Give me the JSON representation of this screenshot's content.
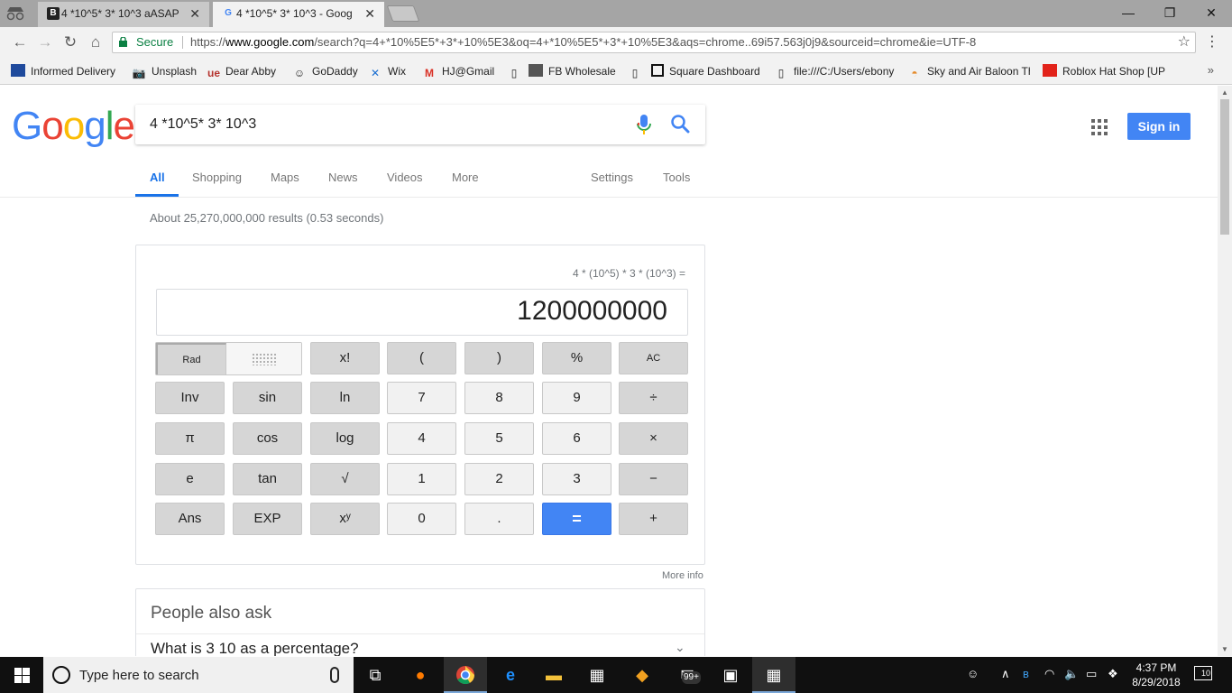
{
  "browser": {
    "tabs": [
      {
        "title": "4 *10^5* 3* 10^3 aASAP",
        "favicon": "B",
        "close": "✕"
      },
      {
        "title": "4 *10^5* 3* 10^3 - Goog",
        "favicon": "G",
        "close": "✕"
      }
    ],
    "window_controls": {
      "minimize": "—",
      "maximize": "❐",
      "close": "✕"
    },
    "address_bar": {
      "secure_label": "Secure",
      "url_prefix": "https://",
      "url_host": "www.google.com",
      "url_rest": "/search?q=4+*10%5E5*+3*+10%5E3&oq=4+*10%5E5*+3*+10%5E3&aqs=chrome..69i57.563j0j9&sourceid=chrome&ie=UTF-8"
    },
    "bookmarks": [
      "Informed Delivery",
      "Unsplash",
      "Dear Abby",
      "GoDaddy",
      "Wix",
      "HJ@Gmail",
      "FB Wholesale",
      "Square Dashboard",
      "file:///C:/Users/ebony",
      "Sky and Air Baloon Th",
      "Roblox Hat Shop [UP"
    ],
    "bookmarks_more": "»"
  },
  "google": {
    "logo": [
      "G",
      "o",
      "o",
      "g",
      "l",
      "e"
    ],
    "query": "4 *10^5* 3* 10^3",
    "signin": "Sign in",
    "nav_tabs": [
      "All",
      "Shopping",
      "Maps",
      "News",
      "Videos",
      "More"
    ],
    "nav_tools": [
      "Settings",
      "Tools"
    ],
    "stats": "About 25,270,000,000 results (0.53 seconds)"
  },
  "calculator": {
    "expression": "4 * (10^5) * 3 * (10^3) =",
    "result": "1200000000",
    "rad": "Rad",
    "keys_row1": [
      "x!",
      "(",
      ")",
      "%",
      "AC"
    ],
    "keys_row2": [
      "Inv",
      "sin",
      "ln",
      "7",
      "8",
      "9",
      "÷"
    ],
    "keys_row3": [
      "π",
      "cos",
      "log",
      "4",
      "5",
      "6",
      "×"
    ],
    "keys_row4": [
      "e",
      "tan",
      "√",
      "1",
      "2",
      "3",
      "−"
    ],
    "keys_row5": [
      "Ans",
      "EXP",
      "xʸ",
      "0",
      ".",
      "=",
      "+"
    ],
    "more_info": "More info"
  },
  "people_also_ask": {
    "title": "People also ask",
    "question": "What is 3 10 as a percentage?"
  },
  "taskbar": {
    "search_placeholder": "Type here to search",
    "time": "4:37 PM",
    "date": "8/29/2018",
    "notifications": "10",
    "mail_badge": "99+"
  }
}
